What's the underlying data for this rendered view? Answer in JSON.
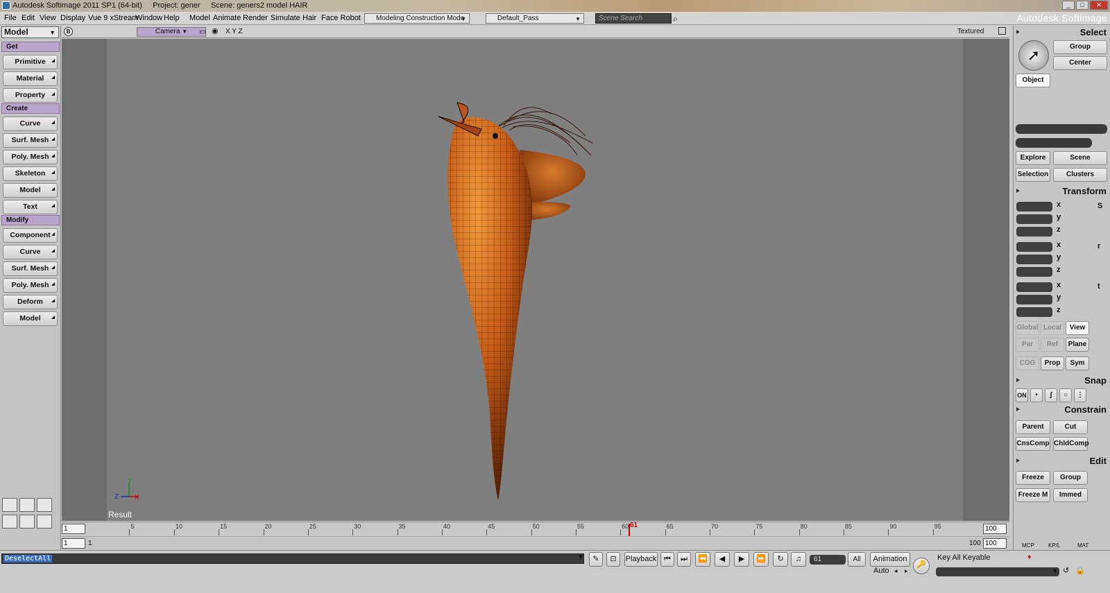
{
  "window": {
    "title": "Autodesk Softimage 2011 SP1 (64-bit)     Project: gener     Scene: geners2 model HAIR",
    "brand": "Autodesk Softimage"
  },
  "menubar": {
    "items": [
      "File",
      "Edit",
      "View",
      "Display",
      "Vue 9 xStream",
      "Window",
      "Help",
      "Model",
      "Animate",
      "Render",
      "Simulate",
      "Hair",
      "Face Robot"
    ],
    "construction_mode": "Modeling Construction Mode",
    "pass": "Default_Pass",
    "scene_search_placeholder": "Scene Search"
  },
  "left": {
    "mode": "Model",
    "sections": {
      "get": "Get",
      "create": "Create",
      "modify": "Modify"
    },
    "get_buttons": [
      "Primitive",
      "Material",
      "Property"
    ],
    "create_buttons": [
      "Curve",
      "Surf. Mesh",
      "Poly. Mesh",
      "Skeleton",
      "Model",
      "Text"
    ],
    "modify_buttons": [
      "Component",
      "Curve",
      "Surf. Mesh",
      "Poly. Mesh",
      "Deform",
      "Model"
    ]
  },
  "viewport": {
    "b_label": "B",
    "camera": "Camera",
    "axes_label": "X Y Z",
    "display_mode": "Textured",
    "result_label": "Result",
    "axis_y": "Y",
    "axis_z": "Z",
    "axis_x": "X"
  },
  "right": {
    "select_header": "Select",
    "group": "Group",
    "center": "Center",
    "object": "Object",
    "explore": "Explore",
    "scene": "Scene",
    "selection": "Selection",
    "clusters": "Clusters",
    "transform_header": "Transform",
    "axis_x": "x",
    "axis_y": "y",
    "axis_z": "z",
    "global": "Global",
    "local": "Local",
    "view": "View",
    "par": "Par",
    "ref": "Ref",
    "plane": "Plane",
    "cog": "COG",
    "prop": "Prop",
    "sym": "Sym",
    "snap_header": "Snap",
    "snap_on": "ON",
    "constrain_header": "Constrain",
    "parent": "Parent",
    "cut": "Cut",
    "cnscomp": "CnsComp",
    "chldcomp": "ChldComp",
    "edit_header": "Edit",
    "freeze": "Freeze",
    "edit_group": "Group",
    "freeze_m": "Freeze M",
    "immed": "Immed",
    "tabs": [
      "MCP",
      "KP/L",
      "MAT"
    ]
  },
  "timeline": {
    "start": "1",
    "end": "100",
    "ticks": [
      "5",
      "10",
      "15",
      "20",
      "25",
      "30",
      "35",
      "40",
      "45",
      "50",
      "55",
      "60",
      "65",
      "70",
      "75",
      "80",
      "85",
      "90",
      "95"
    ],
    "current_frame": "61",
    "range_start": "1",
    "range_start_small": "1",
    "range_end": "100",
    "range_end_small": "100"
  },
  "bottom": {
    "command": "DeselectAll",
    "playback": "Playback",
    "frame_field": "61",
    "all": "All",
    "animation": "Animation",
    "auto": "Auto",
    "key_all_keyable": "Key All Keyable"
  }
}
